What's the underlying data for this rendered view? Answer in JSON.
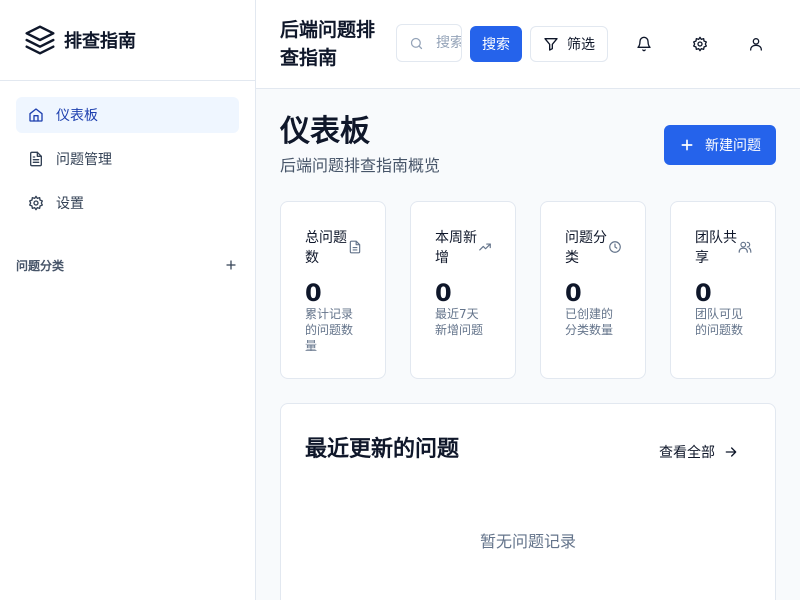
{
  "sidebar": {
    "brand": {
      "name": "排查指南",
      "icon": "layers-icon"
    },
    "nav": [
      {
        "label": "仪表板",
        "icon": "home-icon",
        "active": true
      },
      {
        "label": "问题管理",
        "icon": "file-text-icon",
        "active": false
      },
      {
        "label": "设置",
        "icon": "gear-icon",
        "active": false
      }
    ],
    "categories": {
      "label": "问题分类",
      "add_icon": "plus-icon"
    }
  },
  "header": {
    "title": "后端问题排查指南",
    "search": {
      "placeholder": "搜索问题",
      "value": ""
    },
    "search_button": "搜索",
    "filter_button": "筛选",
    "icons": [
      "bell-icon",
      "gear-icon",
      "user-icon"
    ]
  },
  "main": {
    "title": "仪表板",
    "subtitle": "后端问题排查指南概览",
    "new_button": "新建问题",
    "stats": [
      {
        "title": "总问题数",
        "value": "0",
        "desc": "累计记录的问题数量",
        "icon": "file-icon"
      },
      {
        "title": "本周新增",
        "value": "0",
        "desc": "最近7天新增问题",
        "icon": "trending-up-icon"
      },
      {
        "title": "问题分类",
        "value": "0",
        "desc": "已创建的分类数量",
        "icon": "clock-icon"
      },
      {
        "title": "团队共享",
        "value": "0",
        "desc": "团队可见的问题数",
        "icon": "users-icon"
      }
    ],
    "recent": {
      "title": "最近更新的问题",
      "view_all": "查看全部",
      "empty": "暂无问题记录"
    }
  },
  "colors": {
    "primary": "#2563eb",
    "active_bg": "#eff6ff",
    "border": "#e2e8f0"
  }
}
